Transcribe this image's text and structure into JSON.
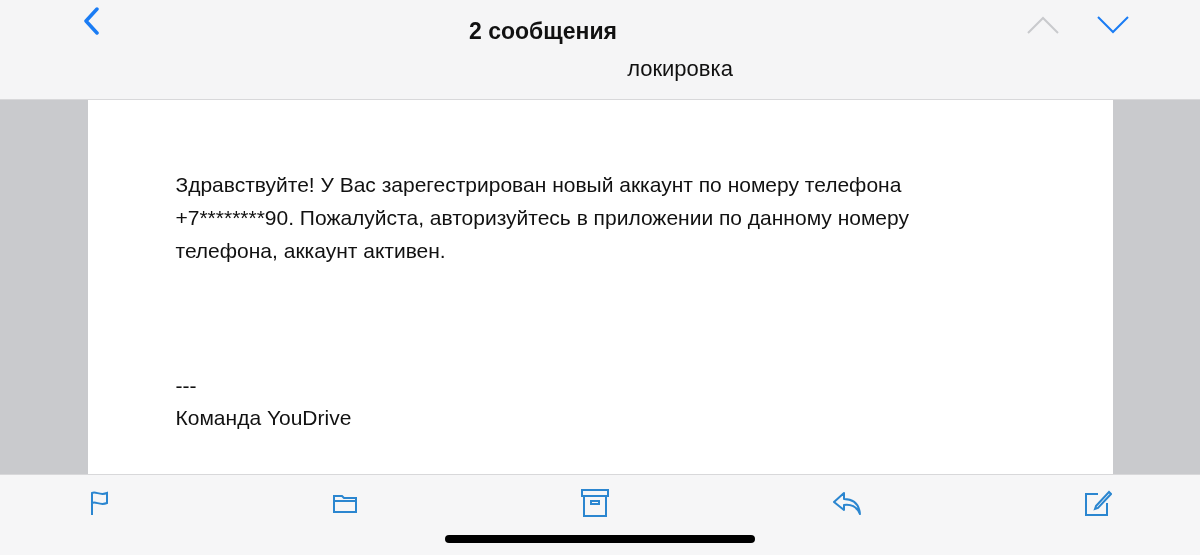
{
  "nav": {
    "title": "2 сообщения",
    "subject": "локировка",
    "prev_disabled": true,
    "next_disabled": false
  },
  "message": {
    "paragraph": "Здравствуйте! У Вас зарегестрирован новый аккаунт по номеру телефона +7********90. Пожалуйста, авторизуйтесь в приложении по данному номеру телефона, аккаунт активен.",
    "separator": "---",
    "signature": "Команда YouDrive"
  },
  "toolbar": [
    {
      "kind": "flag"
    },
    {
      "kind": "folder"
    },
    {
      "kind": "archive"
    },
    {
      "kind": "reply"
    },
    {
      "kind": "compose"
    }
  ]
}
